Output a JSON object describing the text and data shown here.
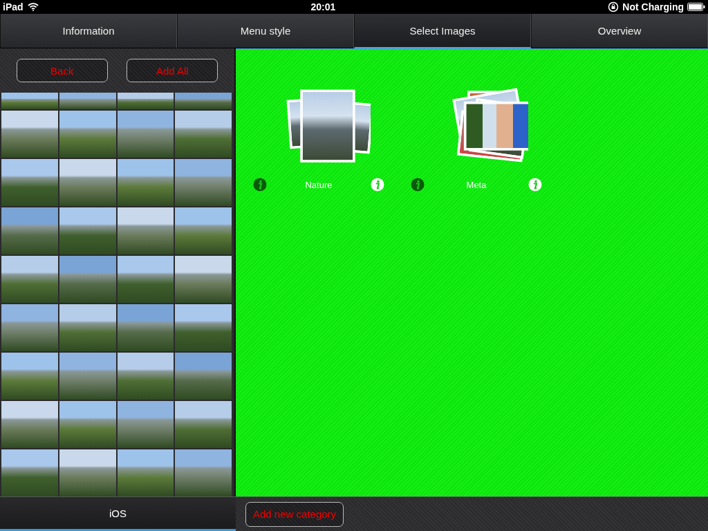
{
  "status_bar": {
    "device": "iPad",
    "time": "20:01",
    "battery": "Not Charging"
  },
  "tabs": [
    {
      "label": "Information",
      "selected": false
    },
    {
      "label": "Menu style",
      "selected": false
    },
    {
      "label": "Select Images",
      "selected": true
    },
    {
      "label": "Overview",
      "selected": false
    }
  ],
  "image_panel": {
    "buttons": [
      "Back",
      "Add All"
    ],
    "footer": "iOS"
  },
  "categories": [
    {
      "name": "Nature",
      "kind": "landscape"
    },
    {
      "name": "Meta",
      "kind": "portrait"
    }
  ],
  "add_button": "Add new category"
}
